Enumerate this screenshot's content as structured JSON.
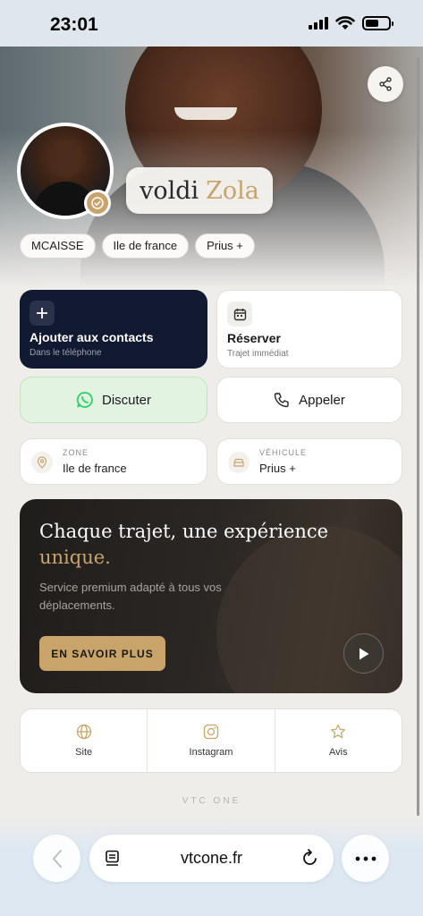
{
  "status_bar": {
    "time": "23:01"
  },
  "profile": {
    "first_name": "voldi",
    "last_name": "Zola",
    "tags": [
      "MCAISSE",
      "Ile de france",
      "Prius +"
    ]
  },
  "actions": {
    "contacts": {
      "title": "Ajouter aux contacts",
      "subtitle": "Dans le téléphone"
    },
    "reserve": {
      "title": "Réserver",
      "subtitle": "Trajet immédiat"
    },
    "chat": {
      "label": "Discuter"
    },
    "call": {
      "label": "Appeler"
    }
  },
  "info": {
    "zone": {
      "key": "ZONE",
      "value": "Ile de france"
    },
    "vehicle": {
      "key": "VÉHICULE",
      "value": "Prius +"
    }
  },
  "promo": {
    "headline_part1": "Chaque trajet, une expérience ",
    "headline_accent": "unique.",
    "description": "Service premium adapté à tous vos déplacements.",
    "cta": "EN SAVOIR PLUS"
  },
  "links": [
    {
      "label": "Site",
      "icon": "globe-icon"
    },
    {
      "label": "Instagram",
      "icon": "instagram-icon"
    },
    {
      "label": "Avis",
      "icon": "star-icon"
    }
  ],
  "footer_brand": "VTC ONE",
  "browser": {
    "url": "vtcone.fr"
  },
  "colors": {
    "gold": "#c8a46b",
    "navy": "#121a31",
    "whatsapp": "#25d366"
  }
}
